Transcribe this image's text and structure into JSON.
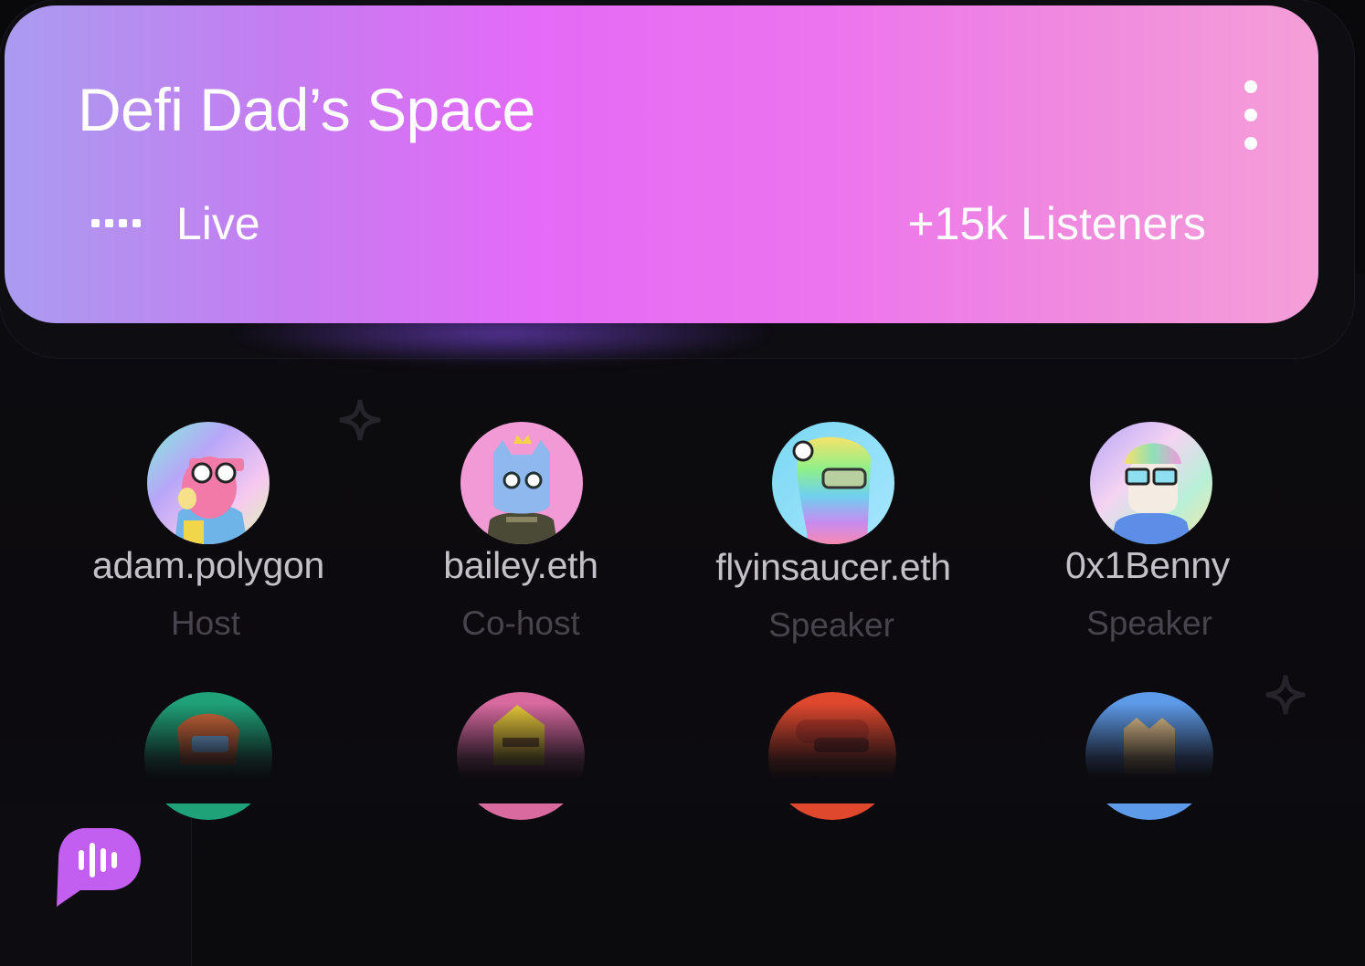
{
  "space": {
    "title": "Defi Dad’s Space",
    "status": "Live",
    "listeners": "+15k Listeners"
  },
  "speakers": [
    {
      "name": "adam.polygon",
      "role": "Host"
    },
    {
      "name": "bailey.eth",
      "role": "Co-host"
    },
    {
      "name": "flyinsaucer.eth",
      "role": "Speaker"
    },
    {
      "name": "0x1Benny",
      "role": "Speaker"
    }
  ],
  "icons": {
    "menu": "more-vertical-icon",
    "live": "live-dots-icon",
    "spaces": "spaces-audio-bubble-icon",
    "decor": "sparkle-icon"
  },
  "colors": {
    "card_gradient_start": "#aa9cf0",
    "card_gradient_mid": "#e36bf6",
    "card_gradient_end": "#f59fd8",
    "background": "#09080b",
    "name_text": "#c3c1c8",
    "role_text": "#46444c",
    "bubble": "#c25ef0"
  }
}
